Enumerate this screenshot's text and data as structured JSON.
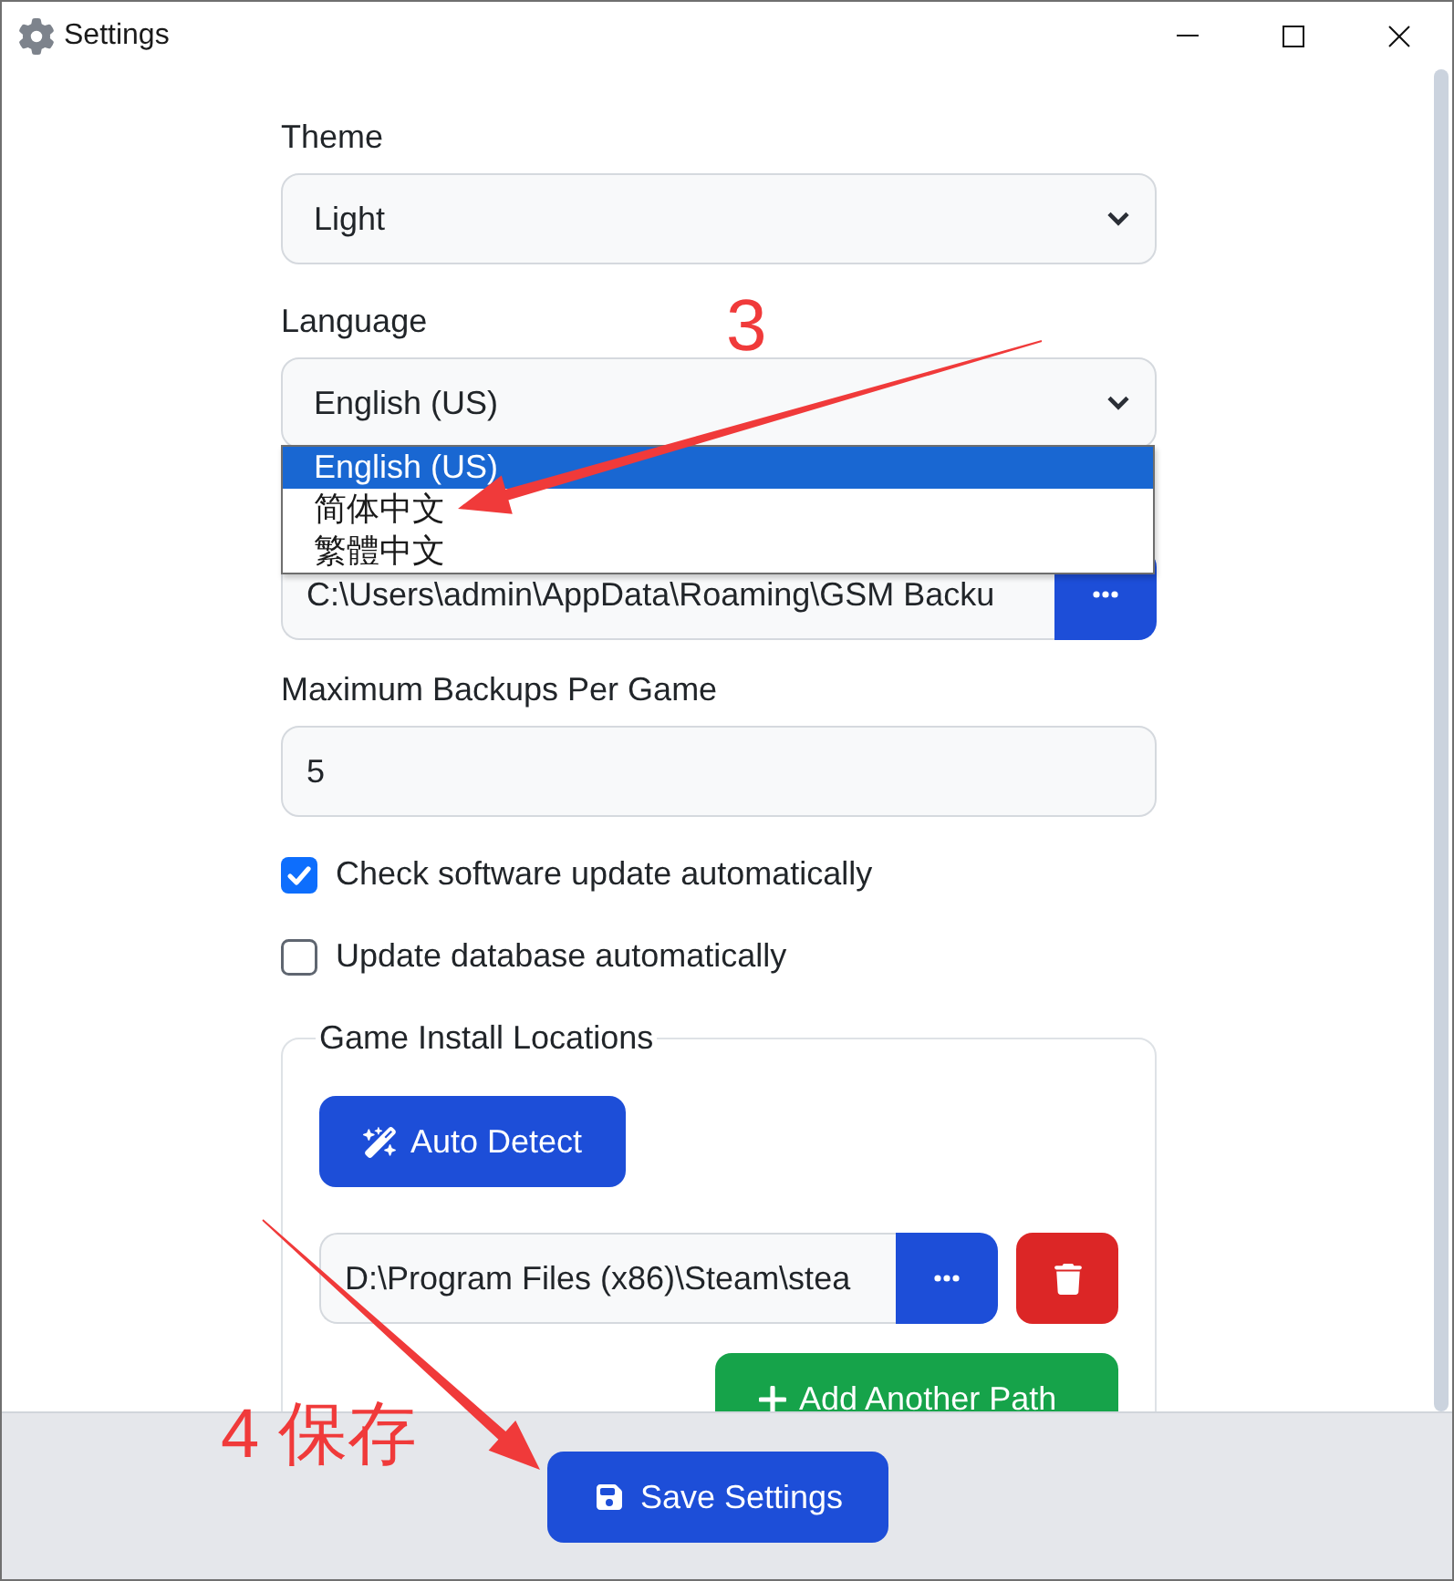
{
  "window": {
    "title": "Settings"
  },
  "form": {
    "theme": {
      "label": "Theme",
      "value": "Light"
    },
    "language": {
      "label": "Language",
      "value": "English (US)",
      "expanded": true,
      "options": [
        {
          "label": "English (US)",
          "selected": true
        },
        {
          "label": "简体中文",
          "selected": false
        },
        {
          "label": "繁體中文",
          "selected": false
        }
      ]
    },
    "backup_location": {
      "value": "C:\\Users\\admin\\AppData\\Roaming\\GSM Backu"
    },
    "max_backups": {
      "label": "Maximum Backups Per Game",
      "value": "5"
    },
    "checkboxes": [
      {
        "label": "Check software update automatically",
        "checked": true
      },
      {
        "label": "Update database automatically",
        "checked": false
      }
    ],
    "install_locations": {
      "legend": "Game Install Locations",
      "auto_detect": "Auto Detect",
      "paths": [
        {
          "value": "D:\\Program Files (x86)\\Steam\\stea"
        }
      ],
      "add_button": "Add Another Path"
    }
  },
  "footer": {
    "save_button": "Save Settings"
  },
  "annotations": [
    {
      "label": "3"
    },
    {
      "label": "4 保存"
    }
  ]
}
